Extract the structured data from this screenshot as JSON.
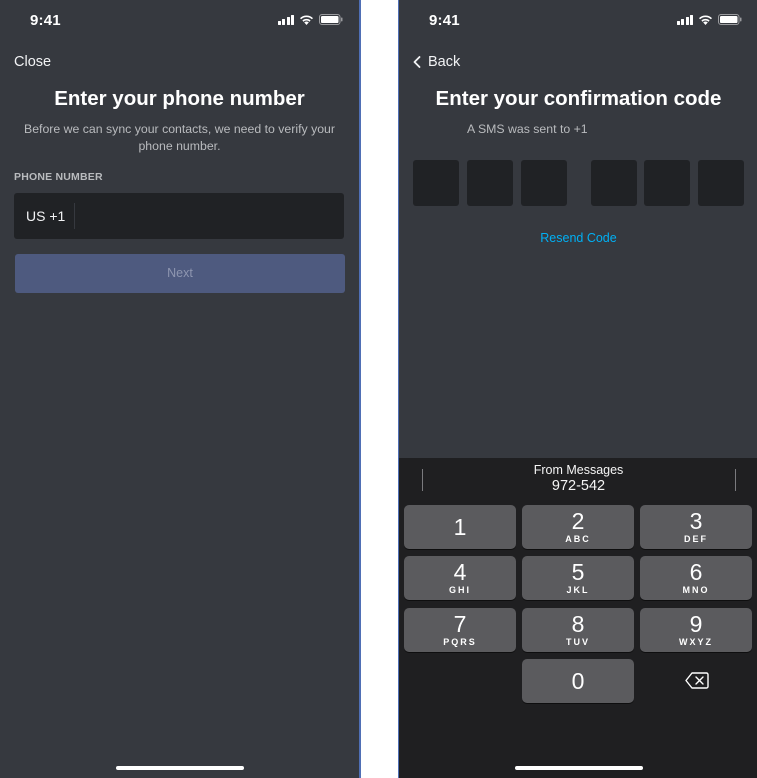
{
  "left_screen": {
    "status": {
      "time": "9:41"
    },
    "close_label": "Close",
    "title": "Enter your phone number",
    "subtitle": "Before we can sync your contacts, we need to verify your phone number.",
    "phone_label": "PHONE NUMBER",
    "country_code": "US +1",
    "phone_value": "",
    "next_label": "Next"
  },
  "right_screen": {
    "status": {
      "time": "9:41"
    },
    "back_label": "Back",
    "title": "Enter your confirmation code",
    "subtitle": "A SMS was sent to +1",
    "code_digits": [
      "",
      "",
      "",
      "",
      "",
      ""
    ],
    "resend_label": "Resend Code",
    "keyboard": {
      "suggestion_title": "From Messages",
      "suggestion_code": "972-542",
      "keys": [
        {
          "digit": "1",
          "letters": ""
        },
        {
          "digit": "2",
          "letters": "ABC"
        },
        {
          "digit": "3",
          "letters": "DEF"
        },
        {
          "digit": "4",
          "letters": "GHI"
        },
        {
          "digit": "5",
          "letters": "JKL"
        },
        {
          "digit": "6",
          "letters": "MNO"
        },
        {
          "digit": "7",
          "letters": "PQRS"
        },
        {
          "digit": "8",
          "letters": "TUV"
        },
        {
          "digit": "9",
          "letters": "WXYZ"
        },
        {
          "digit": "0",
          "letters": ""
        }
      ]
    }
  },
  "colors": {
    "background": "#36393f",
    "input": "#202225",
    "button_disabled": "#4e5a7f",
    "link": "#00b0f4",
    "keyboard": "#1f1f21",
    "key": "#5b5b5e"
  }
}
